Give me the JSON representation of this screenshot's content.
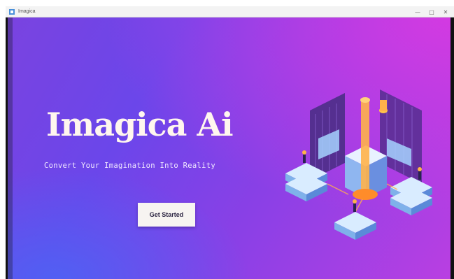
{
  "window": {
    "title": "Imagica",
    "minimize_glyph": "—",
    "maximize_glyph": "□",
    "close_glyph": "✕"
  },
  "hero": {
    "title": "Imagica Ai",
    "subtitle": "Convert Your Imagination Into Reality",
    "cta_label": "Get Started"
  },
  "icons": {
    "app": "app-icon",
    "illustration": "isometric-data-center-illustration"
  },
  "colors": {
    "gradient_start": "#6b46ea",
    "gradient_end": "#d63ae2",
    "title_text": "#fff6ee",
    "button_bg": "#f7f4f1"
  }
}
